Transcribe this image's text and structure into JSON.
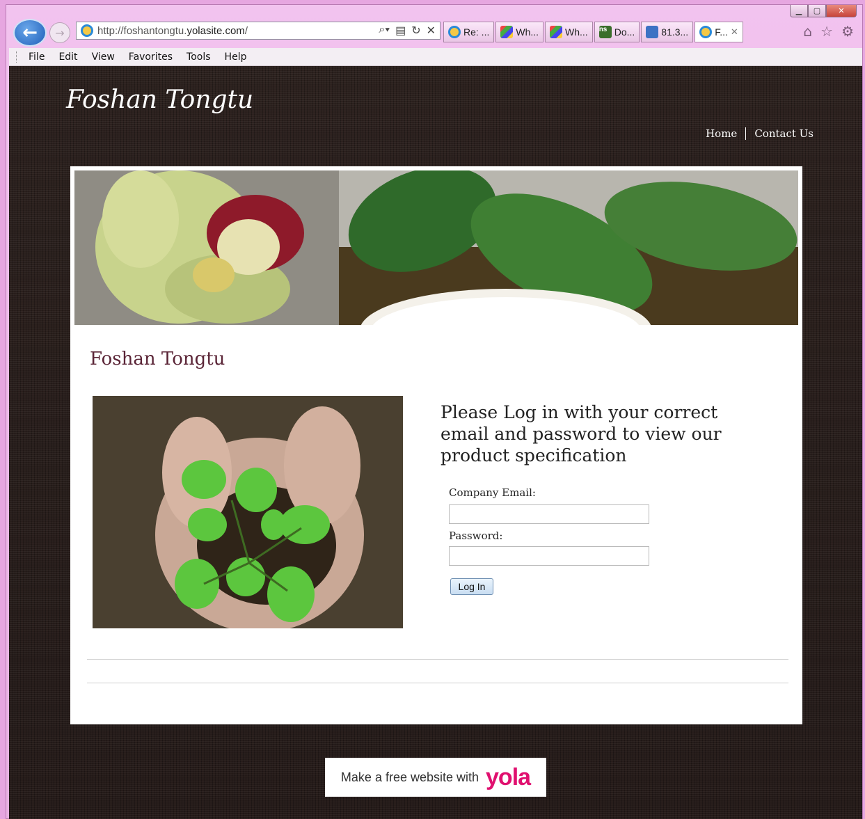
{
  "browser": {
    "url_prefix": "http://foshantongtu.",
    "url_domain": "yolasite.com",
    "url_suffix": "/",
    "tabs": [
      {
        "label": "Re: ...",
        "icon": "ie-icon"
      },
      {
        "label": "Wh...",
        "icon": "google-icon"
      },
      {
        "label": "Wh...",
        "icon": "google-icon"
      },
      {
        "label": "Do...",
        "icon": "ns-icon"
      },
      {
        "label": "81.3...",
        "icon": "search-page-icon"
      },
      {
        "label": "F...",
        "icon": "ie-icon",
        "active": true
      }
    ],
    "menu": [
      "File",
      "Edit",
      "View",
      "Favorites",
      "Tools",
      "Help"
    ]
  },
  "site": {
    "title": "Foshan Tongtu",
    "nav": {
      "home": "Home",
      "contact": "Contact Us"
    },
    "page_heading": "Foshan Tongtu",
    "login": {
      "heading": "Please Log in with your correct email and password to view our product specification",
      "email_label": "Company Email:",
      "password_label": "Password:",
      "button": "Log In"
    },
    "footer_badge": {
      "text": "Make a free website with",
      "logo": "yola"
    }
  }
}
